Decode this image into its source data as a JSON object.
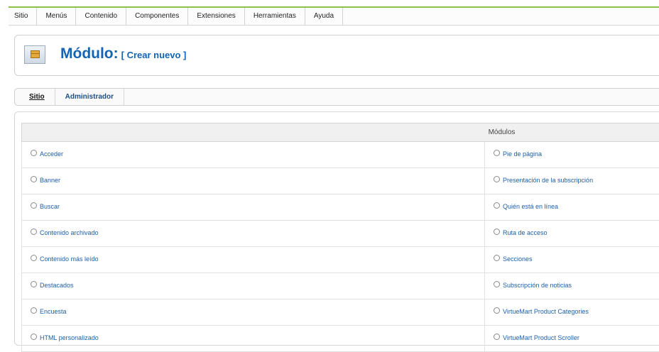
{
  "menu": [
    "Sitio",
    "Menús",
    "Contenido",
    "Componentes",
    "Extensiones",
    "Herramientas",
    "Ayuda"
  ],
  "header": {
    "title": "Módulo:",
    "subtitle": "[ Crear nuevo ]",
    "icon": "module-box-icon"
  },
  "tabs": [
    {
      "label": "Sitio",
      "active": true
    },
    {
      "label": "Administrador",
      "active": false
    }
  ],
  "table": {
    "header": "Módulos",
    "rows": [
      [
        "Acceder",
        "Pie de página"
      ],
      [
        "Banner",
        "Presentación de la subscripción"
      ],
      [
        "Buscar",
        "Quién está en línea"
      ],
      [
        "Contenido archivado",
        "Ruta de acceso"
      ],
      [
        "Contenido más leído",
        "Secciones"
      ],
      [
        "Destacados",
        "Subscripción de noticias"
      ],
      [
        "Encuesta",
        "VirtueMart Product Categories"
      ],
      [
        "HTML personalizado",
        "VirtueMart Product Scroller"
      ]
    ]
  },
  "colors": {
    "accent": "#1464b4",
    "menu_border": "#8bc34a"
  }
}
